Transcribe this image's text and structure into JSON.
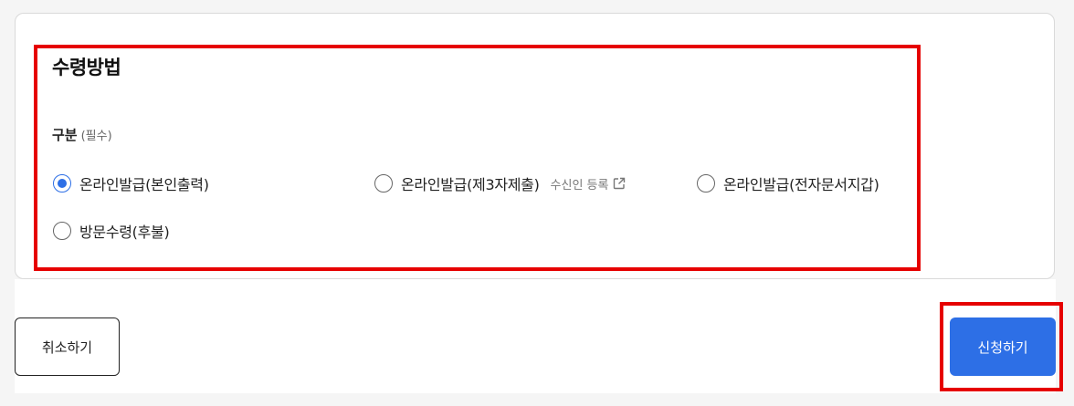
{
  "section": {
    "title": "수령방법",
    "field_label": "구분",
    "field_hint": "(필수)"
  },
  "options": [
    {
      "label": "온라인발급(본인출력)",
      "checked": true
    },
    {
      "label": "온라인발급(제3자제출)",
      "checked": false
    },
    {
      "label": "온라인발급(전자문서지갑)",
      "checked": false
    },
    {
      "label": "방문수령(후불)",
      "checked": false
    }
  ],
  "recipient_link": {
    "label": "수신인 등록",
    "icon": "external-link-icon"
  },
  "buttons": {
    "cancel": "취소하기",
    "apply": "신청하기"
  },
  "colors": {
    "accent": "#2d6fe6",
    "highlight": "#e60000"
  }
}
